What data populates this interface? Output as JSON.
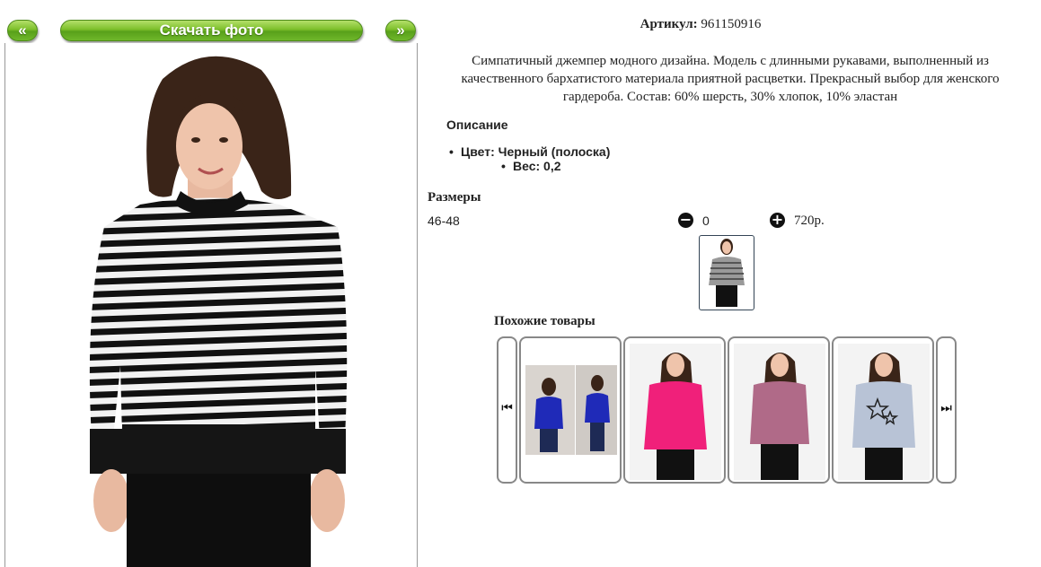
{
  "nav": {
    "prev_label": "«",
    "download_label": "Скачать фото",
    "next_label": "»"
  },
  "product": {
    "article_label": "Артикул:",
    "article_value": "961150916",
    "description": "Симпатичный джемпер модного дизайна. Модель с длинными рукавами, выполненный из качественного бархатистого материала приятной расцветки. Прекрасный выбор для женского гардероба. Состав: 60% шерсть, 30% хлопок, 10% эластан",
    "description_title": "Описание",
    "color_line": "Цвет: Черный (полоска)",
    "weight_line": "Вес: 0,2",
    "sizes_title": "Размеры",
    "size": "46-48",
    "quantity": "0",
    "price": "720р."
  },
  "similar": {
    "title": "Похожие товары",
    "prev_icon": "skip-previous-icon",
    "next_icon": "skip-next-icon"
  },
  "colors": {
    "button_green": "#7cbf2a",
    "card_border": "#888888"
  }
}
